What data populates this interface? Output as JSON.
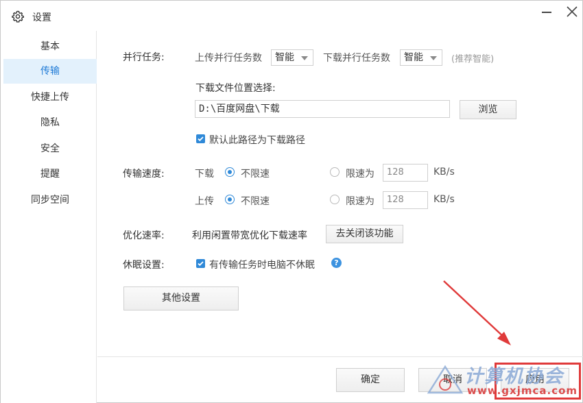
{
  "window": {
    "title": "设置"
  },
  "sidebar": {
    "items": [
      {
        "label": "基本",
        "active": false
      },
      {
        "label": "传输",
        "active": true
      },
      {
        "label": "快捷上传",
        "active": false
      },
      {
        "label": "隐私",
        "active": false
      },
      {
        "label": "安全",
        "active": false
      },
      {
        "label": "提醒",
        "active": false
      },
      {
        "label": "同步空间",
        "active": false
      }
    ]
  },
  "parallel": {
    "label": "并行任务:",
    "upload_label": "上传并行任务数",
    "upload_value": "智能",
    "download_label": "下载并行任务数",
    "download_value": "智能",
    "hint": "(推荐智能)"
  },
  "download_location": {
    "label": "下载文件位置选择:",
    "path": "D:\\百度网盘\\下载",
    "browse_label": "浏览",
    "default_checkbox_label": "默认此路径为下载路径",
    "default_checked": true
  },
  "speed": {
    "label": "传输速度:",
    "download": {
      "label": "下载",
      "unlimited_label": "不限速",
      "limit_label": "限速为",
      "limit_value": "128",
      "unit": "KB/s",
      "unlimited_selected": true
    },
    "upload": {
      "label": "上传",
      "unlimited_label": "不限速",
      "limit_label": "限速为",
      "limit_value": "128",
      "unit": "KB/s",
      "unlimited_selected": true
    }
  },
  "optimize": {
    "label": "优化速率:",
    "description": "利用闲置带宽优化下载速率",
    "button_label": "去关闭该功能"
  },
  "sleep": {
    "label": "休眠设置:",
    "checkbox_label": "有传输任务时电脑不休眠",
    "checked": true,
    "help_glyph": "?"
  },
  "other_settings_label": "其他设置",
  "footer": {
    "ok_label": "确定",
    "cancel_label": "取消",
    "apply_label": "应用"
  },
  "watermark": {
    "text": "计算机协会",
    "url": "www.gxjmca.com"
  },
  "colors": {
    "accent": "#2f89d8",
    "active_bg": "#e3f1fc",
    "highlight": "#e03a3a"
  },
  "icons": {
    "title": "gear-icon",
    "minimize": "minimize-icon",
    "close": "close-icon",
    "help": "help-icon"
  }
}
